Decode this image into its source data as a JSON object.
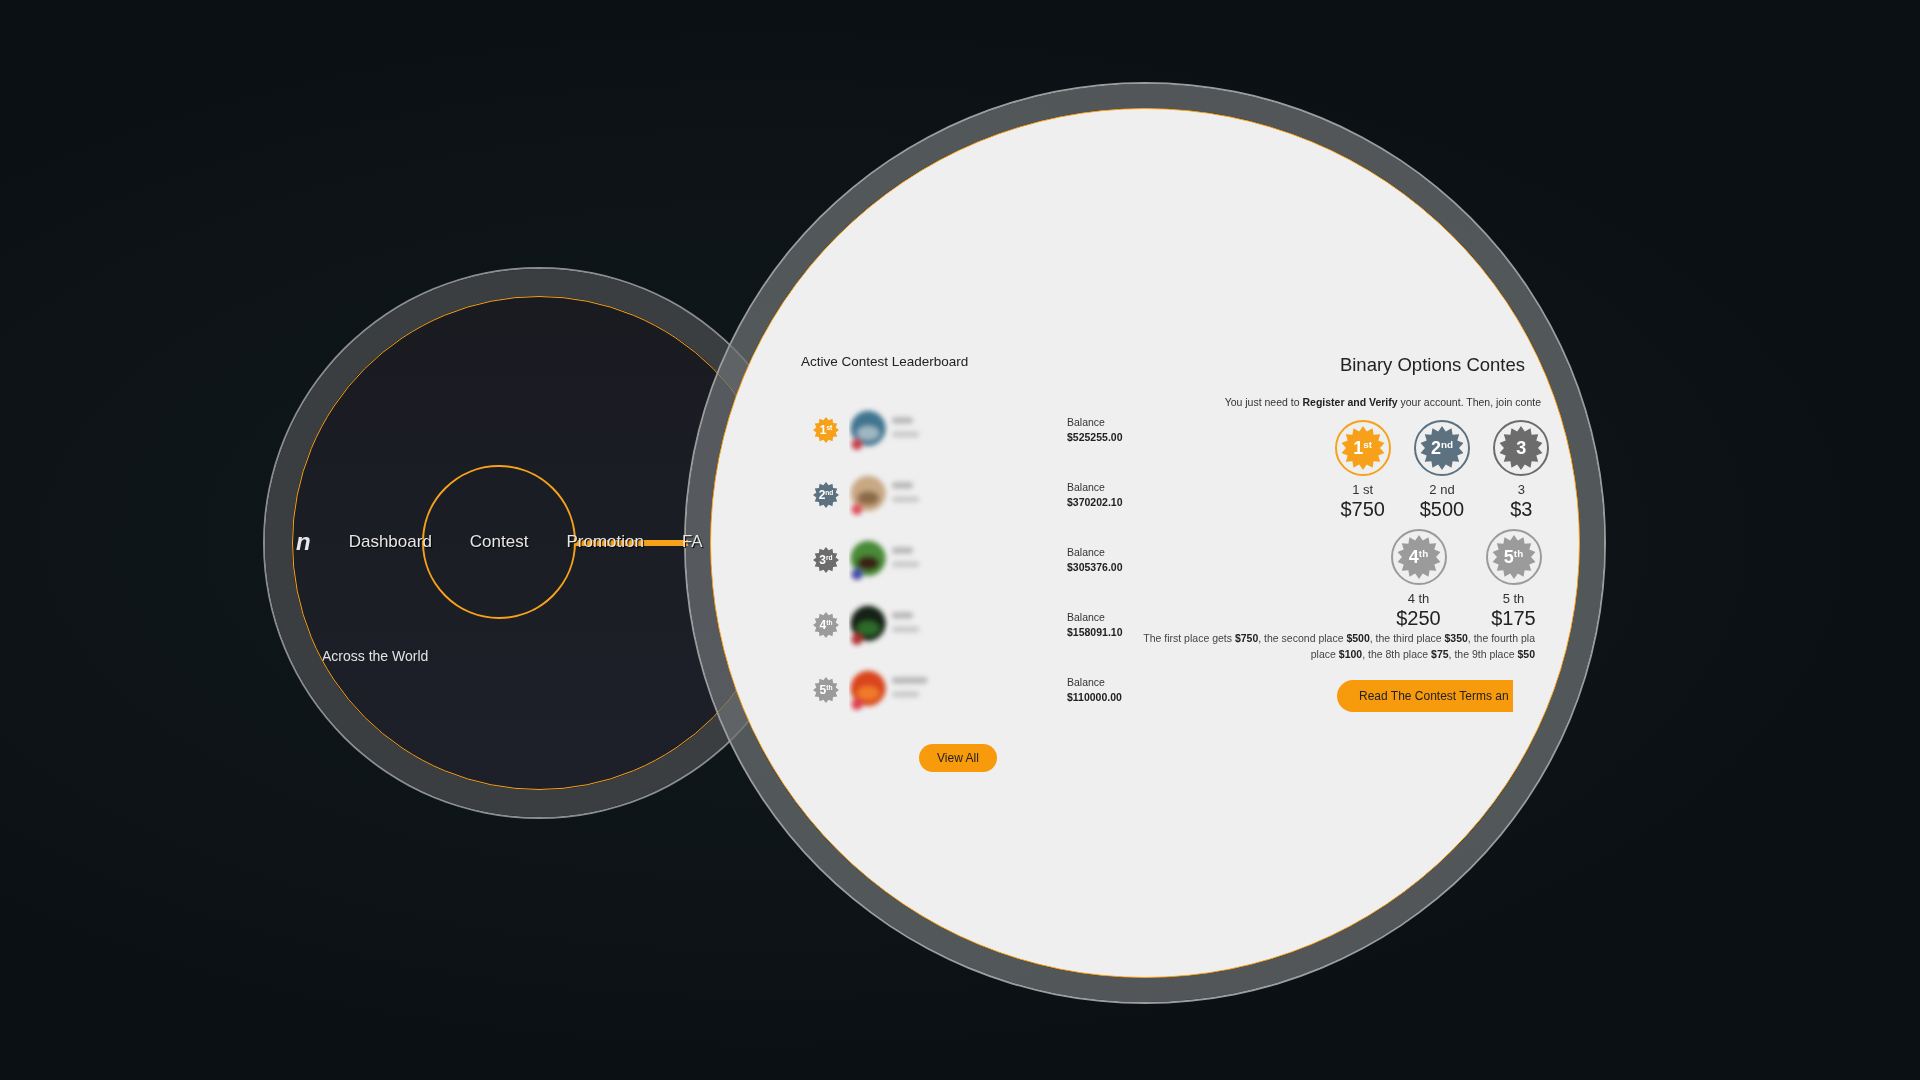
{
  "nav": {
    "logo_fragment": "n",
    "items": [
      {
        "label": "Dashboard",
        "selected": false
      },
      {
        "label": "Contest",
        "selected": true
      },
      {
        "label": "Promotion",
        "selected": false
      },
      {
        "label": "FA",
        "selected": false
      }
    ],
    "tagline": "Across the World"
  },
  "leaderboard": {
    "title": "Active Contest Leaderboard",
    "rows": [
      {
        "rank": "1$^{st}$",
        "color": "#f7a11a",
        "balance_label": "Balance",
        "balance": "$525255.00"
      },
      {
        "rank": "2$^{nd}$",
        "color": "#5d7280",
        "balance_label": "Balance",
        "balance": "$370202.10"
      },
      {
        "rank": "3$^{rd}$",
        "color": "#6c6c6c",
        "balance_label": "Balance",
        "balance": "$305376.00"
      },
      {
        "rank": "4$^{th}$",
        "color": "#9b9b9b",
        "balance_label": "Balance",
        "balance": "$158091.10"
      },
      {
        "rank": "5$^{th}$",
        "color": "#9b9b9b",
        "balance_label": "Balance",
        "balance": "$110000.00"
      }
    ],
    "button": "View All"
  },
  "contest": {
    "title": "Binary Options Contes",
    "intro": "You just need to **Register and Verify** your account. Then, join conte",
    "prize_rows": [
      [
        {
          "badge": "1$^{st}$",
          "color": "#f7a11a",
          "place": "1 st",
          "amount": "$750"
        },
        {
          "badge": "2$^{nd}$",
          "color": "#5d7280",
          "place": "2 nd",
          "amount": "$500"
        },
        {
          "badge": "3",
          "color": "#6c6c6c",
          "place": "3",
          "amount": "$3"
        }
      ],
      [
        {
          "badge": "4$^{th}$",
          "color": "#9b9b9b",
          "place": "4 th",
          "amount": "$250"
        },
        {
          "badge": "5$^{th}$",
          "color": "#9b9b9b",
          "place": "5 th",
          "amount": "$175"
        }
      ]
    ],
    "terms_lines": [
      "The first place gets **$750**, the second place **$500**, the third place **$350**, the fourth pla",
      "place **$100**, the 8th place **$75**, the 9th place **$50**"
    ],
    "button": "Read The Contest Terms an"
  }
}
